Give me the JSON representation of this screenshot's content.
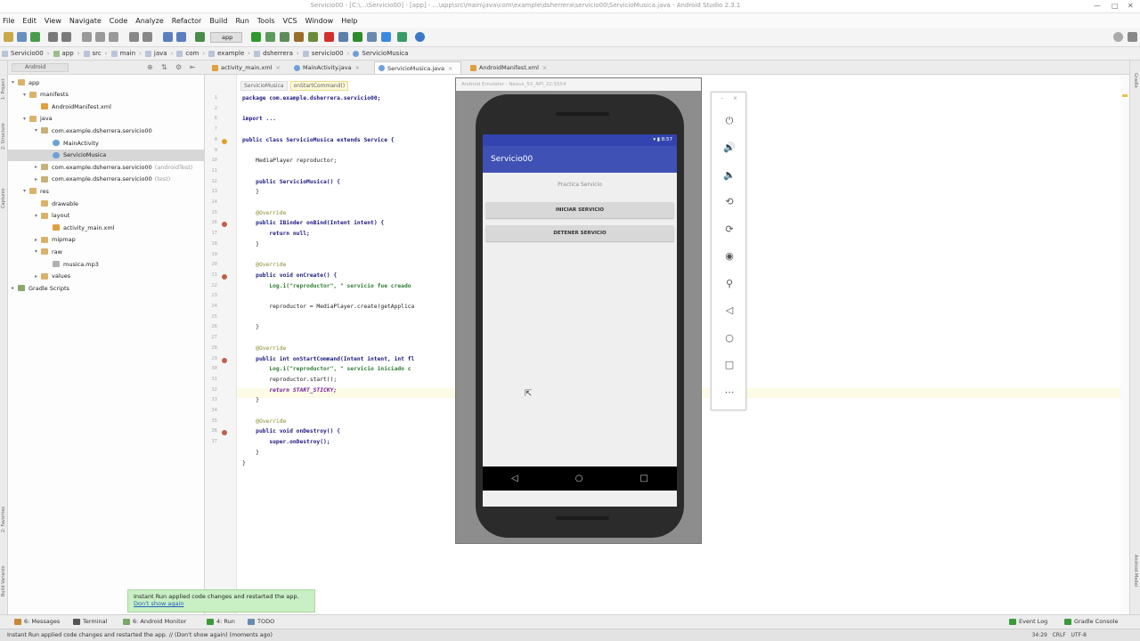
{
  "window": {
    "title": "Servicio00 - [C:\\...\\Servicio00] - [app] - ...\\app\\src\\main\\java\\com\\example\\dsherrera\\servicio00\\ServicioMusica.java - Android Studio 2.3.1"
  },
  "menu": [
    "File",
    "Edit",
    "View",
    "Navigate",
    "Code",
    "Analyze",
    "Refactor",
    "Build",
    "Run",
    "Tools",
    "VCS",
    "Window",
    "Help"
  ],
  "toolbar": {
    "run_config": "app"
  },
  "breadcrumbs": [
    "Servicio00",
    "app",
    "src",
    "main",
    "java",
    "com",
    "example",
    "dsherrera",
    "servicio00",
    "ServicioMusica"
  ],
  "project_panel": {
    "view_selector": "Android",
    "tree": [
      {
        "label": "app",
        "indent": 0,
        "arrow": "▾",
        "icon": "folder"
      },
      {
        "label": "manifests",
        "indent": 1,
        "arrow": "▾",
        "icon": "folder"
      },
      {
        "label": "AndroidManifest.xml",
        "indent": 2,
        "arrow": "",
        "icon": "xml"
      },
      {
        "label": "java",
        "indent": 1,
        "arrow": "▾",
        "icon": "folder"
      },
      {
        "label": "com.example.dsherrera.servicio00",
        "indent": 2,
        "arrow": "▾",
        "icon": "package"
      },
      {
        "label": "MainActivity",
        "indent": 3,
        "arrow": "",
        "icon": "class"
      },
      {
        "label": "ServicioMusica",
        "indent": 3,
        "arrow": "",
        "icon": "class",
        "selected": true
      },
      {
        "label": "com.example.dsherrera.servicio00",
        "suffix": "(androidTest)",
        "indent": 2,
        "arrow": "▸",
        "icon": "package"
      },
      {
        "label": "com.example.dsherrera.servicio00",
        "suffix": "(test)",
        "indent": 2,
        "arrow": "▸",
        "icon": "package"
      },
      {
        "label": "res",
        "indent": 1,
        "arrow": "▾",
        "icon": "folder"
      },
      {
        "label": "drawable",
        "indent": 2,
        "arrow": "",
        "icon": "folder"
      },
      {
        "label": "layout",
        "indent": 2,
        "arrow": "▾",
        "icon": "folder"
      },
      {
        "label": "activity_main.xml",
        "indent": 3,
        "arrow": "",
        "icon": "xml"
      },
      {
        "label": "mipmap",
        "indent": 2,
        "arrow": "▸",
        "icon": "folder"
      },
      {
        "label": "raw",
        "indent": 2,
        "arrow": "▾",
        "icon": "folder"
      },
      {
        "label": "musica.mp3",
        "indent": 3,
        "arrow": "",
        "icon": "file"
      },
      {
        "label": "values",
        "indent": 2,
        "arrow": "▸",
        "icon": "folder"
      },
      {
        "label": "Gradle Scripts",
        "indent": 0,
        "arrow": "▸",
        "icon": "gradle"
      }
    ]
  },
  "editor_tabs": [
    {
      "label": "activity_main.xml",
      "icon": "xml"
    },
    {
      "label": "MainActivity.java",
      "icon": "class"
    },
    {
      "label": "ServicioMusica.java",
      "icon": "class",
      "active": true
    },
    {
      "label": "AndroidManifest.xml",
      "icon": "xml"
    }
  ],
  "code_breadcrumbs": [
    "ServicioMusica",
    "onStartCommand()"
  ],
  "code": {
    "line_numbers": [
      "1",
      "2",
      "6",
      "7",
      "8",
      "9",
      "10",
      "11",
      "12",
      "13",
      "14",
      "15",
      "16",
      "17",
      "18",
      "19",
      "20",
      "21",
      "22",
      "23",
      "24",
      "25",
      "26",
      "27",
      "28",
      "29",
      "30",
      "31",
      "32",
      "33",
      "34",
      "35",
      "36",
      "37"
    ],
    "lines": [
      "package com.example.dsherrera.servicio00;",
      "",
      "import ...",
      "",
      "public class ServicioMusica extends Service {",
      "",
      "    MediaPlayer reproductor;",
      "",
      "    public ServicioMusica() {",
      "    }",
      "",
      "    @Override",
      "    public IBinder onBind(Intent intent) {",
      "        return null;",
      "    }",
      "",
      "    @Override",
      "    public void onCreate() {",
      "        Log.i(\"reproductor\", \" servicio fue creado",
      "",
      "        reproductor = MediaPlayer.create(getApplica",
      "",
      "    }",
      "",
      "    @Override",
      "    public int onStartCommand(Intent intent, int fl",
      "        Log.i(\"reproductor\", \" servicio iniciado c",
      "        reproductor.start();",
      "        return START_STICKY;",
      "    }",
      "",
      "    @Override",
      "    public void onDestroy() {",
      "        super.onDestroy();",
      "    }",
      "}"
    ]
  },
  "emulator": {
    "window_title": "Android Emulator - Nexus_5X_API_22:5554",
    "status_time": "8:57",
    "app_title": "Servicio00",
    "subtitle": "Practica Servicio",
    "button_start": "INICIAR SERVICIO",
    "button_stop": "DETENER SERVICIO"
  },
  "balloon": {
    "text": "Instant Run applied code changes and restarted the app.",
    "link": "Don't show again"
  },
  "bottom_tools_left": [
    "6: Messages",
    "Terminal",
    "6: Android Monitor",
    "4: Run",
    "TODO"
  ],
  "bottom_tools_right": [
    "Event Log",
    "Gradle Console"
  ],
  "status": {
    "message": "Instant Run applied code changes and restarted the app. // (Don't show again) (moments ago)",
    "position": "34:29",
    "line_sep": "CRLF",
    "encoding": "UTF-8"
  },
  "side_tabs_left": [
    "1: Project",
    "2: Structure",
    "Captures",
    "Build Variants",
    "2: Favorites"
  ],
  "side_tabs_right": [
    "Gradle",
    "Android Model"
  ],
  "colors": {
    "app_bar": "#3f51b5",
    "status_bar": "#3344b0",
    "balloon": "#c9efc4",
    "selection": "#d7d7d7"
  }
}
